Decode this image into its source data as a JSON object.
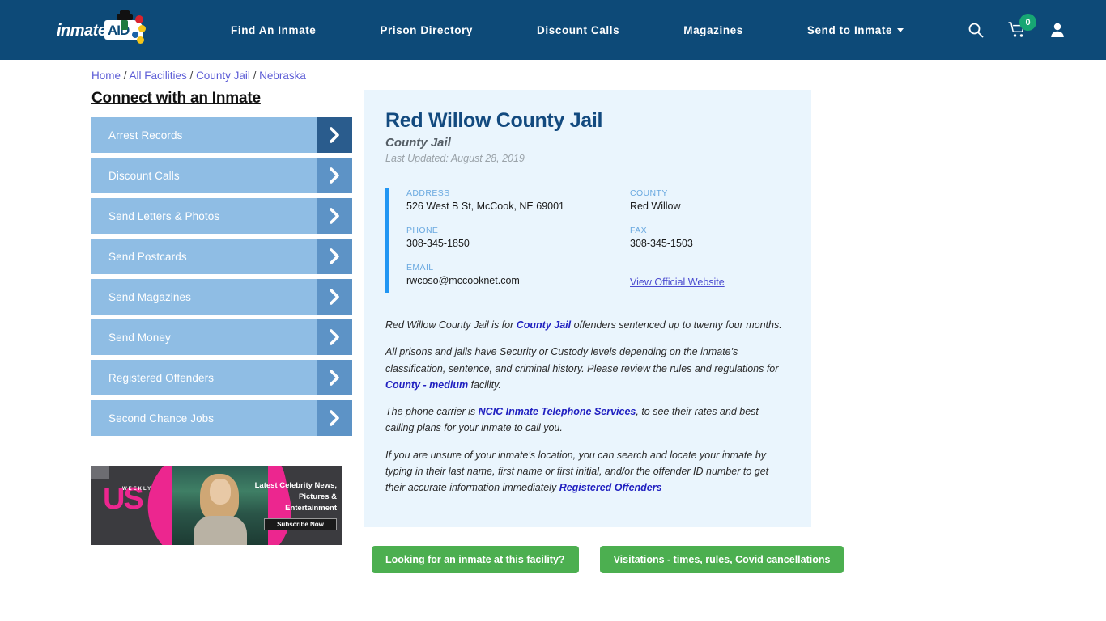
{
  "header": {
    "brand": {
      "text_primary": "inmate",
      "text_secondary": "AID"
    },
    "nav": [
      {
        "label": "Find An Inmate",
        "has_caret": false
      },
      {
        "label": "Prison Directory",
        "has_caret": false
      },
      {
        "label": "Discount Calls",
        "has_caret": false
      },
      {
        "label": "Magazines",
        "has_caret": false
      },
      {
        "label": "Send to Inmate",
        "has_caret": true
      }
    ],
    "icons": {
      "search": "search-icon",
      "cart": "cart-icon",
      "cart_count": "0",
      "account": "user-icon"
    },
    "colors": {
      "background": "#0d4a78",
      "badge": "#17a673"
    }
  },
  "breadcrumb": {
    "items": [
      "Home",
      "All Facilities",
      "County Jail",
      "Nebraska"
    ],
    "separator": "/"
  },
  "sidebar": {
    "title": "Connect with an Inmate",
    "items": [
      {
        "label": "Arrest Records"
      },
      {
        "label": "Discount Calls"
      },
      {
        "label": "Send Letters & Photos"
      },
      {
        "label": "Send Postcards"
      },
      {
        "label": "Send Magazines"
      },
      {
        "label": "Send Money"
      },
      {
        "label": "Registered Offenders"
      },
      {
        "label": "Second Chance Jobs"
      }
    ],
    "colors": {
      "button": "#8fbde4",
      "arrow_box": "#5d93c6",
      "arrow_box_first": "#2a5c8d"
    }
  },
  "ad": {
    "logo": "US",
    "logo_sub": "WEEKLY",
    "copy": "Latest Celebrity News, Pictures & Entertainment",
    "cta": "Subscribe Now"
  },
  "facility": {
    "name": "Red Willow County Jail",
    "type": "County Jail",
    "last_updated": "Last Updated: August 28, 2019",
    "fields": {
      "address_label": "ADDRESS",
      "address_value": "526 West B St, McCook, NE 69001",
      "county_label": "COUNTY",
      "county_value": "Red Willow",
      "phone_label": "PHONE",
      "phone_value": "308-345-1850",
      "fax_label": "FAX",
      "fax_value": "308-345-1503",
      "email_label": "EMAIL",
      "email_value": "rwcoso@mccooknet.com",
      "website_link": "View Official Website"
    },
    "paragraphs": {
      "p1_a": "Red Willow County Jail is for ",
      "p1_link": "County Jail",
      "p1_b": " offenders sentenced up to twenty four months.",
      "p2_a": "All prisons and jails have Security or Custody levels depending on the inmate's classification, sentence, and criminal history. Please review the rules and regulations for ",
      "p2_link": "County - medium",
      "p2_b": " facility.",
      "p3_a": "The phone carrier is ",
      "p3_link": "NCIC Inmate Telephone Services",
      "p3_b": ", to see their rates and best-calling plans for your inmate to call you.",
      "p4_a": "If you are unsure of your inmate's location, you can search and locate your inmate by typing in their last name, first name or first initial, and/or the offender ID number to get their accurate information immediately ",
      "p4_link": "Registered Offenders"
    },
    "cta_buttons": [
      {
        "label": "Looking for an inmate at this facility?"
      },
      {
        "label": "Visitations - times, rules, Covid cancellations"
      }
    ],
    "colors": {
      "panel_bg": "#eaf5fd",
      "accent_bar": "#2196f3",
      "title": "#134a7f",
      "cta": "#4caf50"
    }
  }
}
